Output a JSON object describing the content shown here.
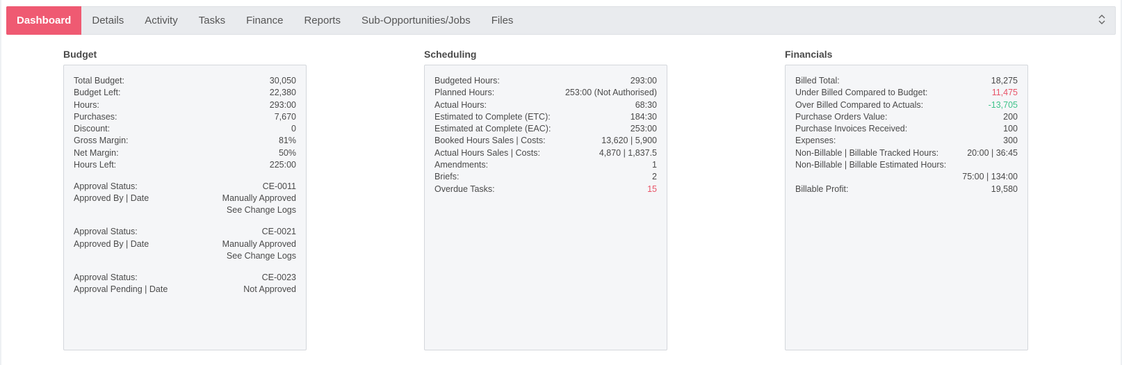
{
  "tabs": [
    {
      "label": "Dashboard",
      "active": true
    },
    {
      "label": "Details"
    },
    {
      "label": "Activity"
    },
    {
      "label": "Tasks"
    },
    {
      "label": "Finance"
    },
    {
      "label": "Reports"
    },
    {
      "label": "Sub-Opportunities/Jobs"
    },
    {
      "label": "Files"
    }
  ],
  "colors": {
    "accent": "#ef5a72",
    "negative": "#e85468",
    "positive": "#3fc38a"
  },
  "budget": {
    "title": "Budget",
    "rows": [
      {
        "label": "Total Budget:",
        "value": "30,050"
      },
      {
        "label": "Budget Left:",
        "value": "22,380"
      },
      {
        "label": "Hours:",
        "value": "293:00"
      },
      {
        "label": "Purchases:",
        "value": "7,670"
      },
      {
        "label": "Discount:",
        "value": "0"
      },
      {
        "label": "Gross Margin:",
        "value": "81%"
      },
      {
        "label": "Net Margin:",
        "value": "50%"
      },
      {
        "label": "Hours Left:",
        "value": "225:00"
      }
    ],
    "approvals": [
      {
        "status_label": "Approval Status:",
        "code": "CE-0011",
        "by_label": "Approved By | Date",
        "by_value": "Manually Approved",
        "link": "See Change Logs"
      },
      {
        "status_label": "Approval Status:",
        "code": "CE-0021",
        "by_label": "Approved By | Date",
        "by_value": "Manually Approved",
        "link": "See Change Logs"
      },
      {
        "status_label": "Approval Status:",
        "code": "CE-0023",
        "by_label": "Approval Pending | Date",
        "by_value": "Not Approved"
      }
    ]
  },
  "scheduling": {
    "title": "Scheduling",
    "rows": [
      {
        "label": "Budgeted Hours:",
        "value": "293:00"
      },
      {
        "label": "Planned Hours:",
        "value": "253:00 (Not Authorised)"
      },
      {
        "label": "Actual Hours:",
        "value": "68:30"
      },
      {
        "label": "Estimated to Complete (ETC):",
        "value": "184:30"
      },
      {
        "label": "Estimated at Complete (EAC):",
        "value": "253:00"
      },
      {
        "label": "Booked Hours Sales | Costs:",
        "value": "13,620 | 5,900"
      },
      {
        "label": "Actual Hours Sales | Costs:",
        "value": "4,870 | 1,837.5"
      },
      {
        "label": "Amendments:",
        "value": "1"
      },
      {
        "label": "Briefs:",
        "value": "2"
      },
      {
        "label": "Overdue Tasks:",
        "value": "15"
      }
    ]
  },
  "financials": {
    "title": "Financials",
    "rows": [
      {
        "label": "Billed Total:",
        "value": "18,275"
      },
      {
        "label": "Under Billed Compared to Budget:",
        "value": "11,475"
      },
      {
        "label": "Over Billed Compared to Actuals:",
        "value": "-13,705"
      },
      {
        "label": "Purchase Orders Value:",
        "value": "200"
      },
      {
        "label": "Purchase Invoices Received:",
        "value": "100"
      },
      {
        "label": "Expenses:",
        "value": "300"
      },
      {
        "label": "Non-Billable | Billable Tracked Hours:",
        "value": "20:00 | 36:45"
      },
      {
        "label": "Non-Billable | Billable Estimated Hours:",
        "value": ""
      },
      {
        "label": "",
        "value": "75:00 | 134:00"
      },
      {
        "label": "Billable Profit:",
        "value": "19,580"
      }
    ]
  }
}
